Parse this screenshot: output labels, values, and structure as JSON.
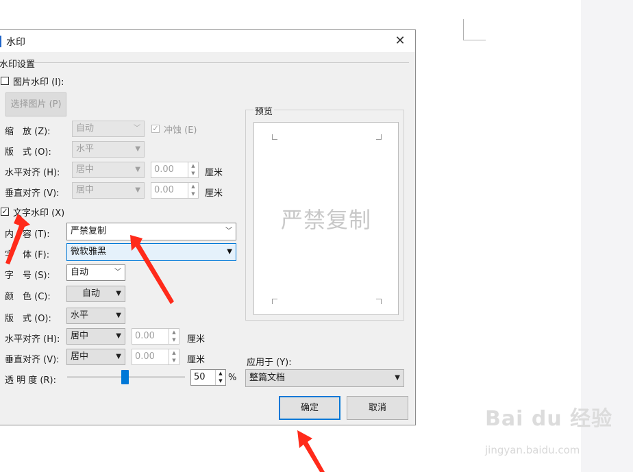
{
  "dialog": {
    "title": "水印",
    "close_glyph": "✕",
    "section_title": "水印设置",
    "image_watermark": {
      "checkbox_label": "图片水印 (I):",
      "checked": false,
      "choose_button": "选择图片 (P)",
      "scale_label": "缩　放 (Z):",
      "scale_value": "自动",
      "washout_label": "冲蚀 (E)",
      "washout_checked": true,
      "layout_label": "版　式 (O):",
      "layout_value": "水平",
      "halign_label": "水平对齐 (H):",
      "halign_value": "居中",
      "halign_offset": "0.00",
      "valign_label": "垂直对齐 (V):",
      "valign_value": "居中",
      "valign_offset": "0.00",
      "unit": "厘米"
    },
    "text_watermark": {
      "checkbox_label": "文字水印 (X)",
      "checked": true,
      "content_label": "内　容 (T):",
      "content_value": "严禁复制",
      "font_label": "字　体 (F):",
      "font_value": "微软雅黑",
      "size_label": "字　号 (S):",
      "size_value": "自动",
      "color_label": "颜　色 (C):",
      "color_value": "自动",
      "layout_label": "版　式 (O):",
      "layout_value": "水平",
      "halign_label": "水平对齐 (H):",
      "halign_value": "居中",
      "halign_offset": "0.00",
      "valign_label": "垂直对齐 (V):",
      "valign_value": "居中",
      "valign_offset": "0.00",
      "unit": "厘米",
      "transparency_label": "透 明 度 (R):",
      "transparency_value": "50",
      "transparency_unit": "%",
      "transparency_level": 0.5
    },
    "preview": {
      "title": "预览",
      "watermark_text": "严禁复制"
    },
    "apply_to": {
      "label": "应用于 (Y):",
      "value": "整篇文档"
    },
    "ok_button": "确定",
    "cancel_button": "取消"
  },
  "brand_watermark": {
    "logo_text": "Bai du 经验",
    "url": "jingyan.baidu.com"
  },
  "colors": {
    "accent": "#0078d7",
    "arrow": "#ff2a1a",
    "dialog_bg": "#f0f0f0"
  }
}
